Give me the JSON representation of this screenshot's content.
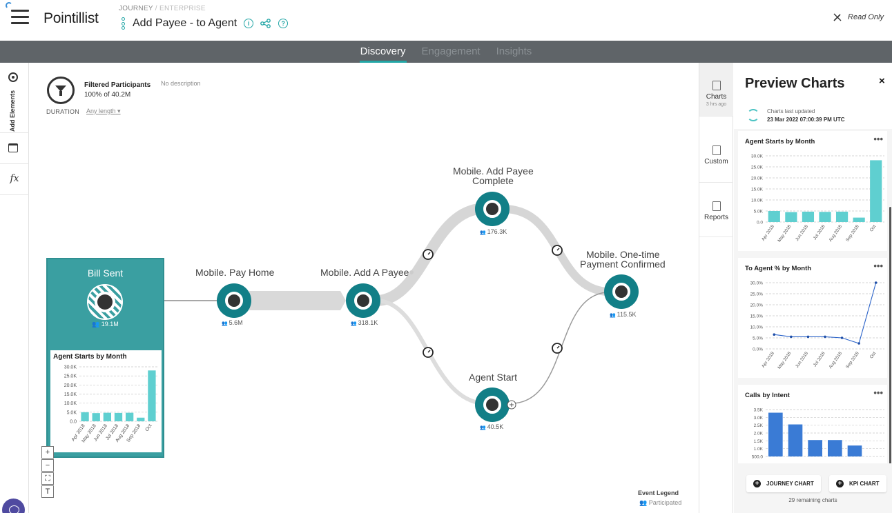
{
  "header": {
    "logo_text": "Pointillist",
    "breadcrumb_parent": "JOURNEY",
    "breadcrumb_current": "ENTERPRISE",
    "journey_title": "Add Payee - to Agent",
    "read_only_label": "Read Only"
  },
  "nav": {
    "tabs": [
      {
        "label": "Discovery",
        "active": true
      },
      {
        "label": "Engagement",
        "active": false
      },
      {
        "label": "Insights",
        "active": false
      }
    ]
  },
  "left_toolbar": {
    "add_elements_label": "Add Elements",
    "fx_label": "fx"
  },
  "canvas": {
    "filtered_label": "Filtered Participants",
    "filtered_value": "100% of 40.2M",
    "description": "No description",
    "duration_label": "DURATION",
    "duration_value": "Any length",
    "nodes": [
      {
        "label": "Bill Sent",
        "count": "19.1M"
      },
      {
        "label": "Mobile. Pay Home",
        "count": "5.6M"
      },
      {
        "label": "Mobile. Add A Payee",
        "count": "318.1K"
      },
      {
        "label_line1": "Mobile. Add Payee",
        "label_line2": "Complete",
        "count": "176.3K"
      },
      {
        "label": "Agent Start",
        "count": "40.5K"
      },
      {
        "label_line1": "Mobile. One-time",
        "label_line2": "Payment Confirmed",
        "count": "115.5K"
      }
    ],
    "legend_title": "Event Legend",
    "legend_item": "Participated",
    "zoom_tools": [
      "+",
      "−",
      "⛶",
      "T"
    ]
  },
  "rail": {
    "items": [
      {
        "label": "Charts",
        "sub": "3 hrs ago",
        "active": true
      },
      {
        "label": "Custom",
        "sub": "",
        "active": false
      },
      {
        "label": "Reports",
        "sub": "",
        "active": false
      }
    ]
  },
  "preview": {
    "title": "Preview Charts",
    "close": "×",
    "updated_label": "Charts last updated",
    "updated_value": "23 Mar 2022 07:00:39 PM UTC",
    "menu": "•••",
    "journey_chart_label": "JOURNEY CHART",
    "kpi_chart_label": "KPI CHART",
    "remaining": "29 remaining charts"
  },
  "colors": {
    "teal": "#22a6a6",
    "bar": "#5fcfd0",
    "blue": "#3a7bd5",
    "nav_bg": "#5f6468"
  },
  "chart_data": [
    {
      "type": "bar",
      "title": "Agent Starts by Month",
      "categories": [
        "Apr 2018",
        "May 2018",
        "Jun 2018",
        "Jul 2018",
        "Aug 2018",
        "Sep 2018",
        "Oct"
      ],
      "values": [
        5000,
        4500,
        4700,
        4600,
        4700,
        2000,
        28000
      ],
      "ytick_labels": [
        "0.0",
        "5.0K",
        "10.0K",
        "15.0K",
        "20.0K",
        "25.0K",
        "30.0K"
      ],
      "ylim": [
        0,
        30000
      ]
    },
    {
      "type": "line",
      "title": "To Agent % by Month",
      "categories": [
        "Apr 2018",
        "May 2018",
        "Jun 2018",
        "Jul 2018",
        "Aug 2018",
        "Sep 2018",
        "Oct"
      ],
      "values": [
        6.5,
        5.5,
        5.5,
        5.5,
        5.0,
        2.5,
        30.0
      ],
      "ytick_labels": [
        "0.0%",
        "5.0%",
        "10.0%",
        "15.0%",
        "20.0%",
        "25.0%",
        "30.0%"
      ],
      "ylim": [
        0,
        30
      ]
    },
    {
      "type": "bar",
      "title": "Calls by Intent",
      "categories": [
        "",
        "",
        "",
        "",
        "",
        ""
      ],
      "values": [
        3300,
        2550,
        1550,
        1550,
        1200,
        0
      ],
      "ytick_labels": [
        "500.0",
        "1.0K",
        "1.5K",
        "2.0K",
        "2.5K",
        "3.0K",
        "3.5K"
      ],
      "ylim": [
        500,
        3500
      ]
    }
  ]
}
